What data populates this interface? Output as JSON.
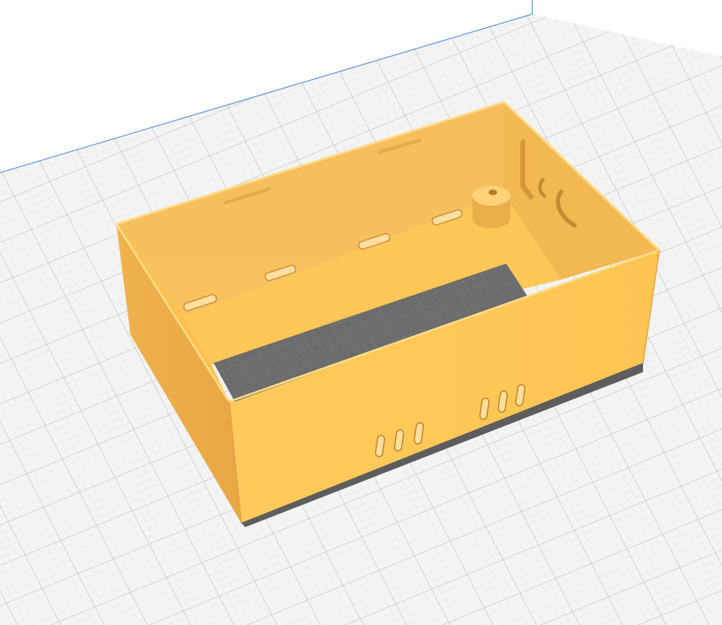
{
  "viewport": {
    "background": "#ffffff",
    "build_plate_color": "#f3f3f3",
    "grid_minor_color": "#e2e2e2",
    "grid_major_color": "#bcbcbc",
    "plate_edge_color": "#6f9fd8"
  },
  "model": {
    "type": "enclosure-box",
    "color": "#ffc55a",
    "shade_light": "#ffd06e",
    "shade_mid": "#f5b955",
    "shade_dark": "#e6a443",
    "shadow_color": "#5c5c5c",
    "opening_color": "#6e6e6e",
    "floor_vents": 4,
    "front_vents": 6,
    "has_standoff_post": true
  }
}
